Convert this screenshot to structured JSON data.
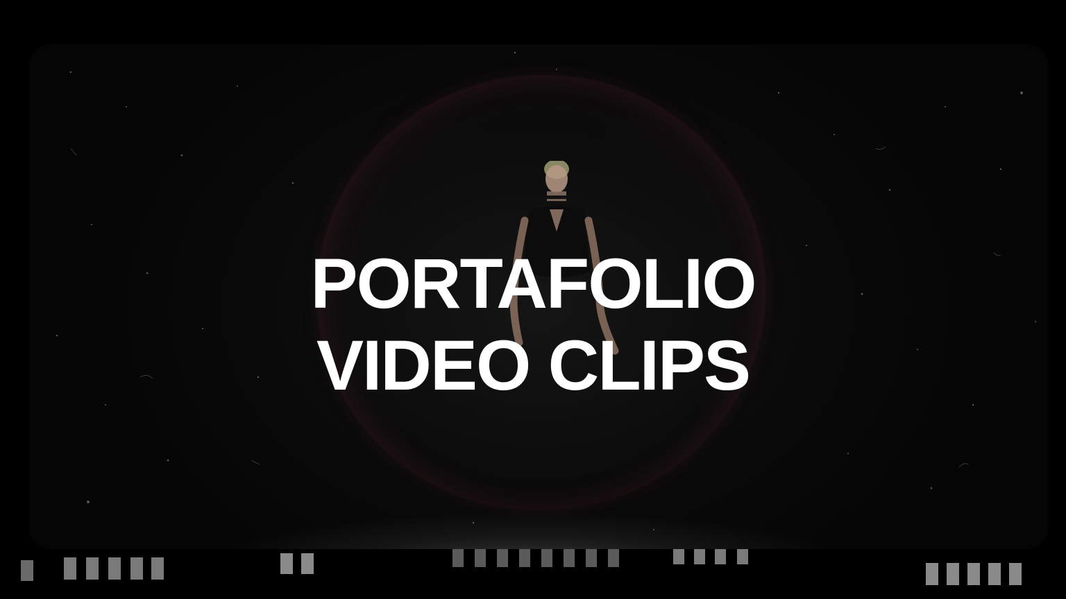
{
  "title": {
    "line1": "PORTAFOLIO",
    "line2": "VIDEO CLIPS"
  },
  "colors": {
    "background": "#000000",
    "text": "#ffffff",
    "bubble_tint": "#5a2430"
  }
}
